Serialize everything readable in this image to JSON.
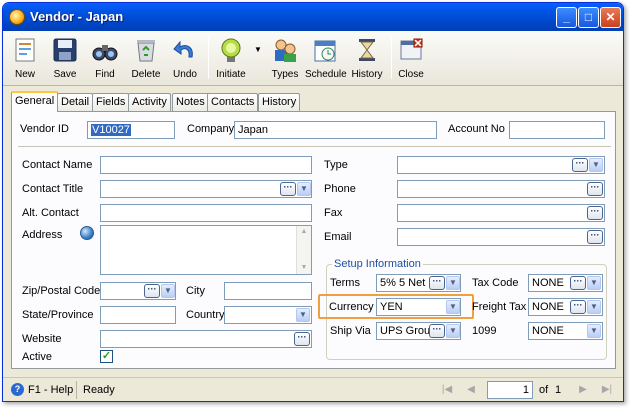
{
  "window": {
    "title": "Vendor - Japan"
  },
  "toolbar": {
    "new": "New",
    "save": "Save",
    "find": "Find",
    "delete": "Delete",
    "undo": "Undo",
    "initiate": "Initiate",
    "types": "Types",
    "schedule": "Schedule",
    "history": "History",
    "close": "Close"
  },
  "tabs": [
    "General",
    "Detail",
    "Fields",
    "Activity",
    "Notes",
    "Contacts",
    "History"
  ],
  "form": {
    "vendor_id_label": "Vendor ID",
    "vendor_id": "V10027",
    "company_label": "Company",
    "company": "Japan",
    "account_label": "Account No",
    "account": "",
    "contact_name_label": "Contact Name",
    "contact_title_label": "Contact Title",
    "alt_contact_label": "Alt. Contact",
    "address_label": "Address",
    "zip_label": "Zip/Postal Code",
    "city_label": "City",
    "state_label": "State/Province",
    "country_label": "Country",
    "website_label": "Website",
    "active_label": "Active",
    "type_label": "Type",
    "phone_label": "Phone",
    "fax_label": "Fax",
    "email_label": "Email",
    "setup_title": "Setup Information",
    "terms_label": "Terms",
    "terms": "5% 5 Net",
    "currency_label": "Currency",
    "currency": "YEN",
    "ship_via_label": "Ship Via",
    "ship_via": "UPS Grou",
    "tax_code_label": "Tax Code",
    "tax_code": "NONE",
    "freight_tax_label": "Freight Tax",
    "freight_tax": "NONE",
    "n1099_label": "1099",
    "n1099": "NONE"
  },
  "status": {
    "help": "F1 - Help",
    "text": "Ready",
    "page": "1",
    "of": "of",
    "total": "1"
  },
  "colors": {
    "titlebar": "#0054e3",
    "highlight": "#f0a040",
    "selection": "#316ac5"
  }
}
